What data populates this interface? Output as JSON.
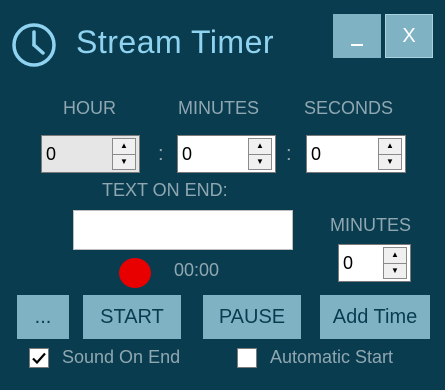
{
  "window": {
    "title": "Stream Timer",
    "minimize_icon": "minimize-icon",
    "close_label": "X"
  },
  "time": {
    "hour_label": "HOUR",
    "minutes_label": "MINUTES",
    "seconds_label": "SECONDS",
    "separator": ":",
    "hour_value": "0",
    "minutes_value": "0",
    "seconds_value": "0"
  },
  "text_on_end": {
    "label": "TEXT ON END:",
    "value": ""
  },
  "add_time": {
    "minutes_label": "MINUTES",
    "minutes_value": "0"
  },
  "status": {
    "indicator_color": "#e80000",
    "elapsed": "00:00"
  },
  "buttons": {
    "more": "...",
    "start": "START",
    "pause": "PAUSE",
    "add_time": "Add Time"
  },
  "options": {
    "sound_on_end": {
      "label": "Sound On End",
      "checked": true
    },
    "automatic_start": {
      "label": "Automatic Start",
      "checked": false
    }
  },
  "colors": {
    "background": "#0a3c50",
    "accent": "#7fb3c4",
    "title_text": "#8fd3f0",
    "label_text": "#8fa7b0"
  }
}
